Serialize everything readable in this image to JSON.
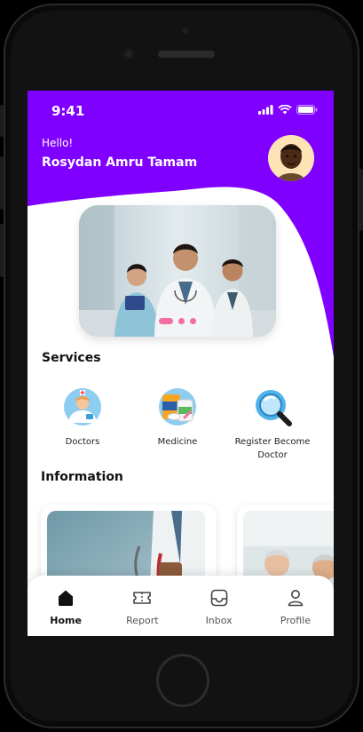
{
  "status_bar": {
    "time": "9:41"
  },
  "header": {
    "greeting": "Hello!",
    "user_name": "Rosydan Amru Tamam"
  },
  "banner": {
    "slide_count": 3,
    "active_slide": 1
  },
  "services": {
    "title": "Services",
    "items": [
      {
        "label": "Doctors",
        "icon": "doctor-icon"
      },
      {
        "label": "Medicine",
        "icon": "medicine-icon"
      },
      {
        "label": "Register Become Doctor",
        "icon": "search-magnifier-icon"
      }
    ]
  },
  "information": {
    "title": "Information"
  },
  "bottom_nav": {
    "items": [
      {
        "label": "Home",
        "icon": "home-icon",
        "active": true
      },
      {
        "label": "Report",
        "icon": "ticket-icon",
        "active": false
      },
      {
        "label": "Inbox",
        "icon": "inbox-icon",
        "active": false
      },
      {
        "label": "Profile",
        "icon": "profile-icon",
        "active": false
      }
    ]
  },
  "colors": {
    "accent": "#8000ff",
    "dot": "#f46da3",
    "avatar_bg": "#fde3b5"
  }
}
